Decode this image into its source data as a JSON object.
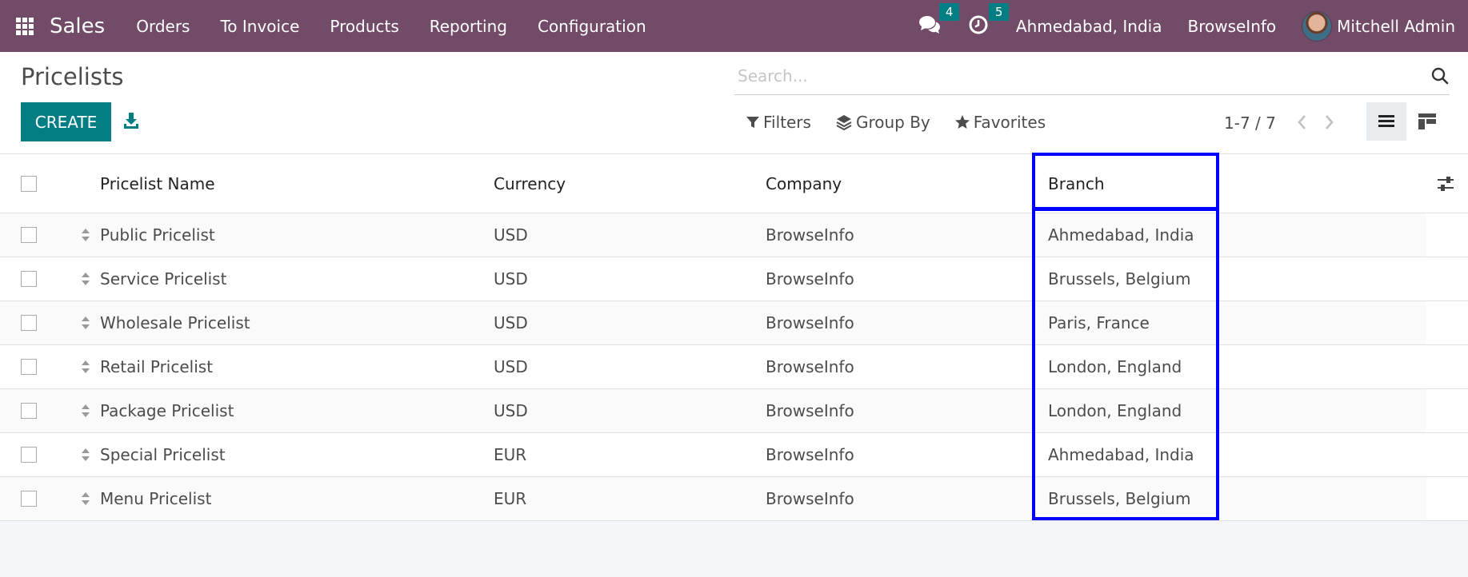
{
  "navbar": {
    "app_name": "Sales",
    "menu": [
      "Orders",
      "To Invoice",
      "Products",
      "Reporting",
      "Configuration"
    ],
    "messages_count": "4",
    "activities_count": "5",
    "branch": "Ahmedabad, India",
    "company": "BrowseInfo",
    "user": "Mitchell Admin"
  },
  "control_panel": {
    "title": "Pricelists",
    "create_label": "CREATE",
    "search_placeholder": "Search...",
    "filters_label": "Filters",
    "group_by_label": "Group By",
    "favorites_label": "Favorites",
    "pager": "1-7 / 7"
  },
  "table": {
    "columns": [
      "Pricelist Name",
      "Currency",
      "Company",
      "Branch"
    ],
    "rows": [
      {
        "name": "Public Pricelist",
        "currency": "USD",
        "company": "BrowseInfo",
        "branch": "Ahmedabad, India"
      },
      {
        "name": "Service Pricelist",
        "currency": "USD",
        "company": "BrowseInfo",
        "branch": "Brussels, Belgium"
      },
      {
        "name": "Wholesale Pricelist",
        "currency": "USD",
        "company": "BrowseInfo",
        "branch": "Paris, France"
      },
      {
        "name": "Retail Pricelist",
        "currency": "USD",
        "company": "BrowseInfo",
        "branch": "London, England"
      },
      {
        "name": "Package Pricelist",
        "currency": "USD",
        "company": "BrowseInfo",
        "branch": "London, England"
      },
      {
        "name": "Special Pricelist",
        "currency": "EUR",
        "company": "BrowseInfo",
        "branch": "Ahmedabad, India"
      },
      {
        "name": "Menu Pricelist",
        "currency": "EUR",
        "company": "BrowseInfo",
        "branch": "Brussels, Belgium"
      }
    ]
  },
  "colors": {
    "navbar": "#714b67",
    "primary": "#017e84",
    "highlight": "#0000ff"
  }
}
